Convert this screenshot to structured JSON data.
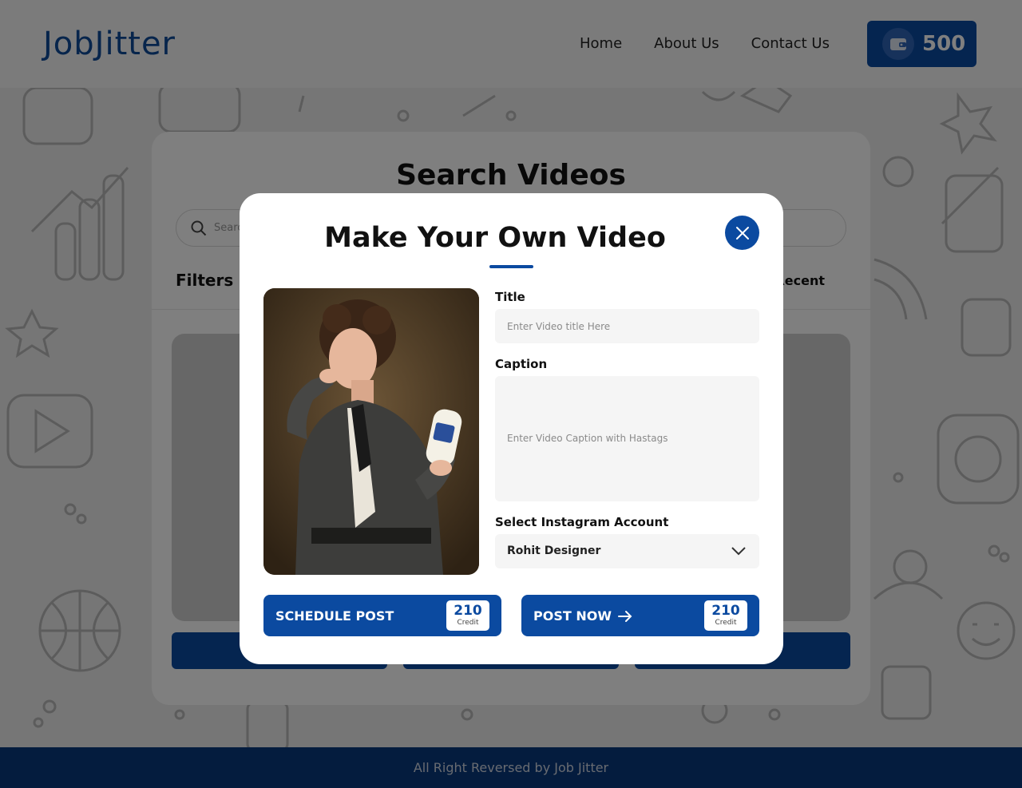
{
  "header": {
    "logo": "JobJitter",
    "nav": [
      {
        "label": "Home"
      },
      {
        "label": "About Us"
      },
      {
        "label": "Contact Us"
      }
    ],
    "wallet_credits": "500"
  },
  "panel": {
    "title": "Search Videos",
    "search_placeholder": "Search",
    "filters_label": "Filters",
    "sort_label": "Recent"
  },
  "footer": {
    "text": "All Right Reversed by Job Jitter"
  },
  "modal": {
    "title": "Make Your Own Video",
    "title_field": {
      "label": "Title",
      "placeholder": "Enter Video title Here"
    },
    "caption_field": {
      "label": "Caption",
      "placeholder": "Enter Video Caption with Hastags"
    },
    "account_field": {
      "label": "Select Instagram Account",
      "value": "Rohit Designer"
    },
    "schedule_button": {
      "label": "SCHEDULE POST",
      "credit": "210",
      "credit_unit": "Credit"
    },
    "post_now_button": {
      "label": "POST NOW",
      "credit": "210",
      "credit_unit": "Credit"
    }
  },
  "colors": {
    "primary": "#0b4aa0",
    "footer": "#08387c"
  }
}
